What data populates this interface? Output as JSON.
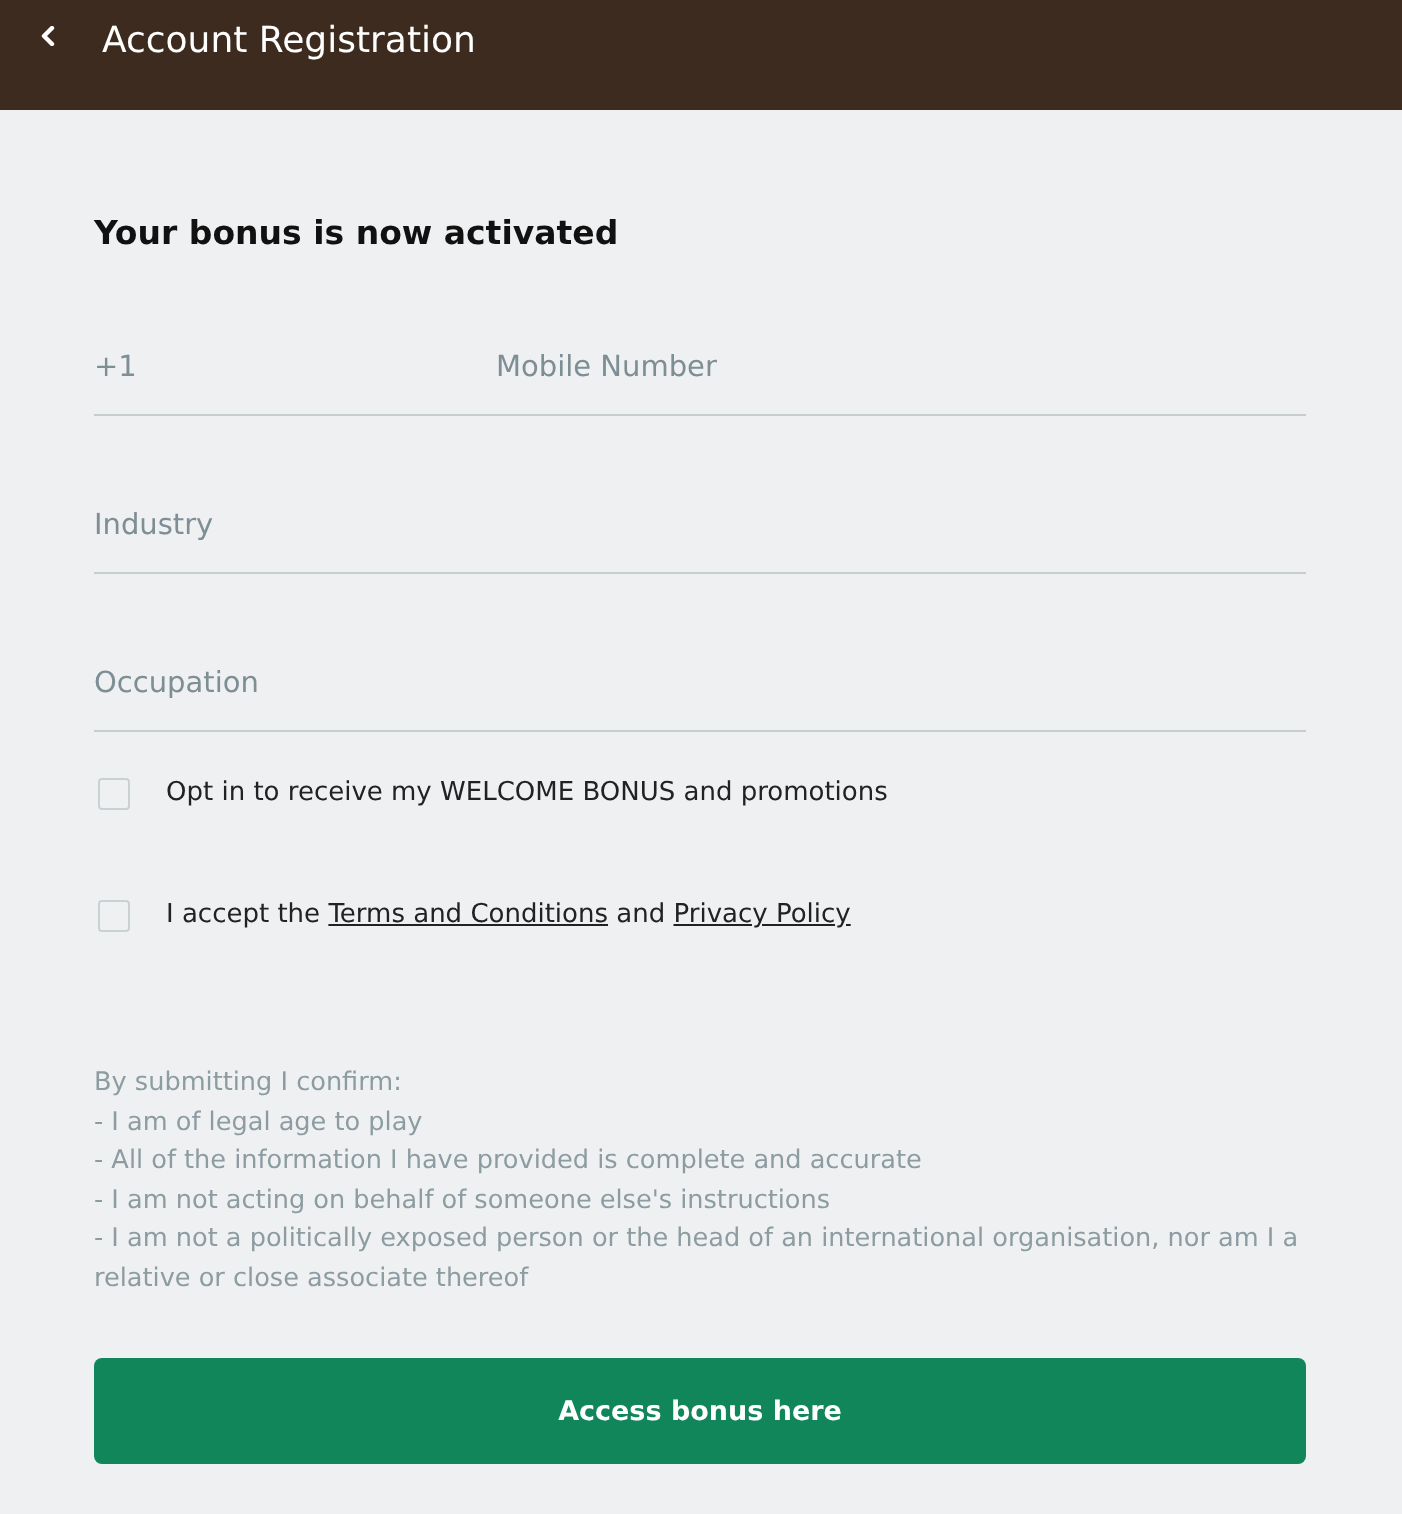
{
  "header": {
    "title": "Account Registration"
  },
  "heading": "Your bonus is now activated",
  "fields": [
    {
      "kind": "phone",
      "prefix": "+1",
      "placeholder": "Mobile Number"
    },
    {
      "kind": "text",
      "placeholder": "Industry"
    },
    {
      "kind": "text",
      "placeholder": "Occupation"
    }
  ],
  "checkboxes": [
    {
      "checked": false,
      "segments": [
        {
          "kind": "text",
          "text": "Opt in to receive my WELCOME BONUS and promotions"
        }
      ]
    },
    {
      "checked": false,
      "segments": [
        {
          "kind": "text",
          "text": "I accept the "
        },
        {
          "kind": "link",
          "text": "Terms and Conditions"
        },
        {
          "kind": "text",
          "text": " and "
        },
        {
          "kind": "link",
          "text": "Privacy Policy"
        }
      ]
    }
  ],
  "disclaimer": {
    "intro": "By submitting I confirm:",
    "items": [
      "- I am of legal age to play",
      "- All of the information I have provided is complete and accurate",
      "- I am not acting on behalf of someone else's instructions",
      "- I am not a politically exposed person or the head of an international organisation, nor am I a relative or close associate thereof"
    ]
  },
  "button": {
    "label": "Access bonus here"
  }
}
